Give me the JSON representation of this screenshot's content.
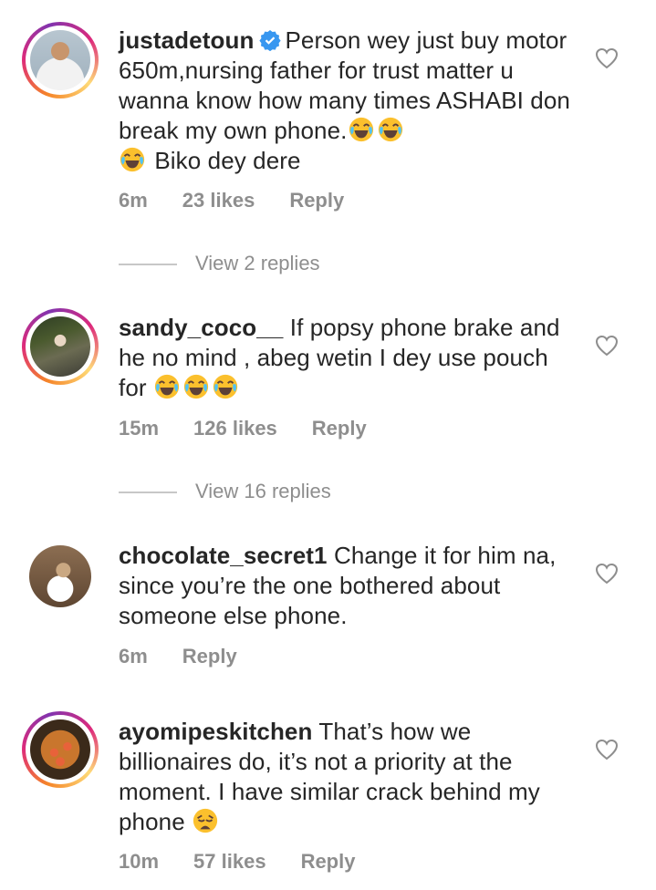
{
  "comments": [
    {
      "username": "justadetoun",
      "verified": true,
      "text": "Person wey just buy motor 650m,nursing father for trust matter u wanna know how many times ASHABI don break my own phone.",
      "text_after": "Biko dey dere",
      "time": "6m",
      "likes": "23 likes",
      "reply": "Reply",
      "view_replies": "View 2 replies"
    },
    {
      "username": "sandy_coco__",
      "verified": false,
      "text": "If popsy phone brake and he no mind , abeg wetin I dey use pouch for",
      "time": "15m",
      "likes": "126 likes",
      "reply": "Reply",
      "view_replies": "View 16 replies"
    },
    {
      "username": "chocolate_secret1",
      "verified": false,
      "text": "Change it for him na, since you’re the one bothered about someone else phone.",
      "time": "6m",
      "reply": "Reply"
    },
    {
      "username": "ayomipeskitchen",
      "verified": false,
      "text": "That’s how we billionaires do, it’s not a priority at the moment. I have similar crack behind my phone",
      "time": "10m",
      "likes": "57 likes",
      "reply": "Reply"
    }
  ],
  "icons": {
    "like": "heart-outline-icon",
    "verified": "verified-badge-icon",
    "laugh_emoji": "face-with-tears-of-joy",
    "weary_emoji": "weary-face"
  },
  "colors": {
    "verified": "#3897f0",
    "meta_text": "#8e8e8e",
    "main_text": "#262626"
  }
}
